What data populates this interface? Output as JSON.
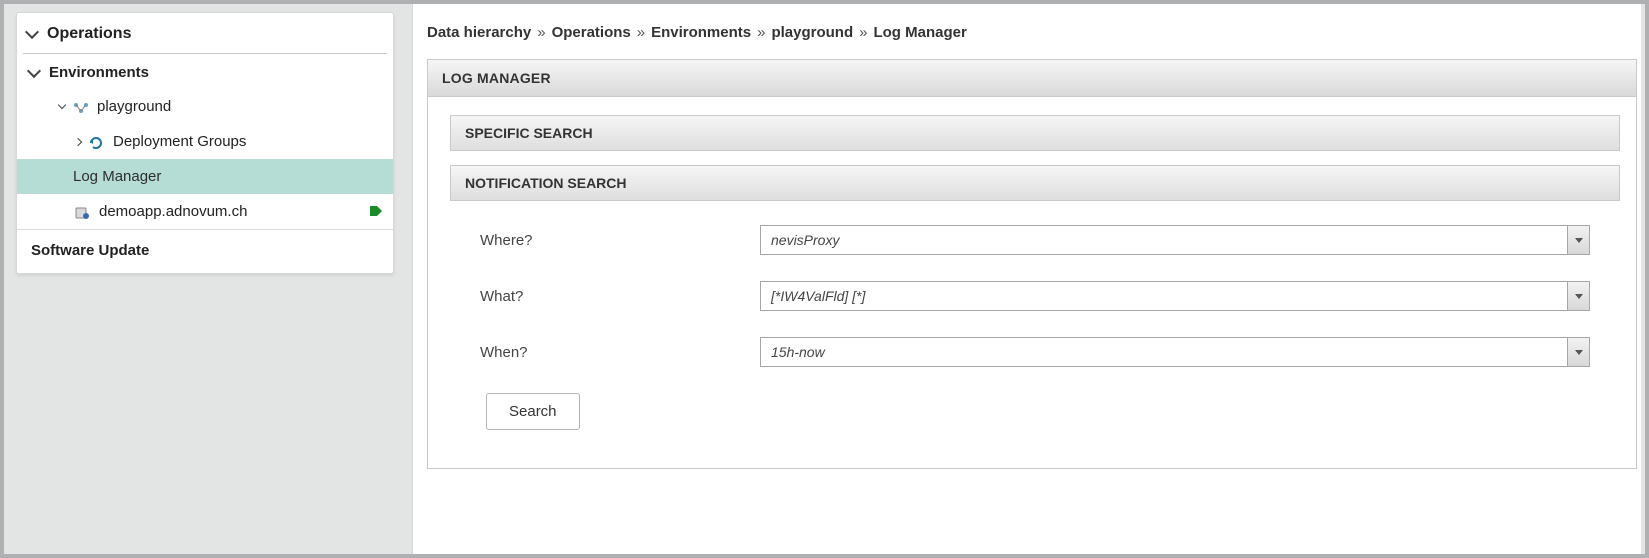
{
  "sidebar": {
    "operations_label": "Operations",
    "environments_label": "Environments",
    "playground_label": "playground",
    "deployment_groups_label": "Deployment Groups",
    "log_manager_label": "Log Manager",
    "host_label": "demoapp.adnovum.ch",
    "software_update_label": "Software Update"
  },
  "breadcrumb": {
    "root": "Data hierarchy",
    "a": "Operations",
    "b": "Environments",
    "c": "playground",
    "d": "Log Manager",
    "sep": "»"
  },
  "panel": {
    "title": "LOG MANAGER",
    "specific_search": "SPECIFIC SEARCH",
    "notification_search": "NOTIFICATION SEARCH"
  },
  "form": {
    "where_label": "Where?",
    "where_value": "nevisProxy",
    "what_label": "What?",
    "what_value": "[*IW4ValFld] [*]",
    "when_label": "When?",
    "when_value": "15h-now",
    "search_button": "Search"
  }
}
